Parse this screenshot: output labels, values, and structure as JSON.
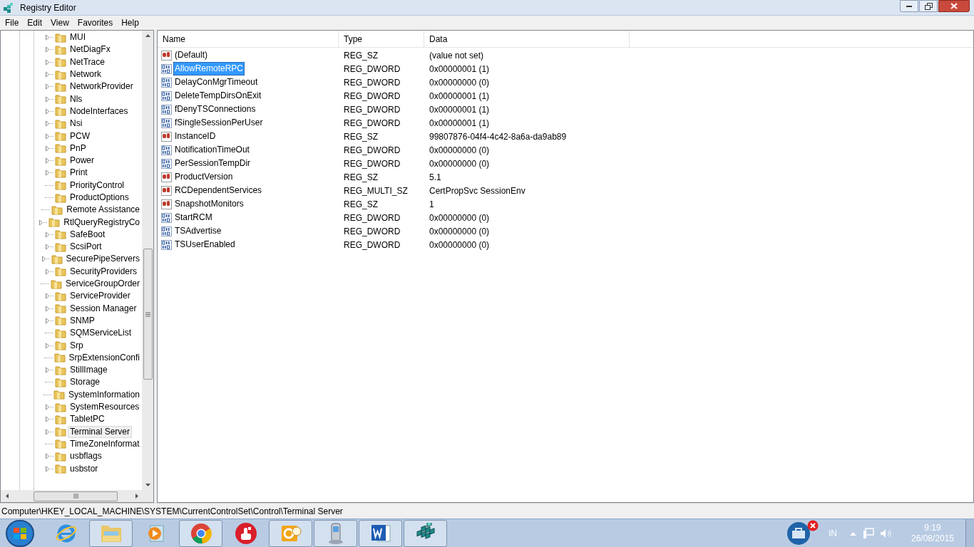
{
  "window": {
    "title": "Registry Editor"
  },
  "menu": [
    "File",
    "Edit",
    "View",
    "Favorites",
    "Help"
  ],
  "tree": {
    "items": [
      {
        "label": "MUI",
        "expandable": true,
        "selected": false
      },
      {
        "label": "NetDiagFx",
        "expandable": true,
        "selected": false
      },
      {
        "label": "NetTrace",
        "expandable": true,
        "selected": false
      },
      {
        "label": "Network",
        "expandable": true,
        "selected": false
      },
      {
        "label": "NetworkProvider",
        "expandable": true,
        "selected": false
      },
      {
        "label": "Nls",
        "expandable": true,
        "selected": false
      },
      {
        "label": "NodeInterfaces",
        "expandable": true,
        "selected": false
      },
      {
        "label": "Nsi",
        "expandable": true,
        "selected": false
      },
      {
        "label": "PCW",
        "expandable": true,
        "selected": false
      },
      {
        "label": "PnP",
        "expandable": true,
        "selected": false
      },
      {
        "label": "Power",
        "expandable": true,
        "selected": false
      },
      {
        "label": "Print",
        "expandable": true,
        "selected": false
      },
      {
        "label": "PriorityControl",
        "expandable": false,
        "selected": false
      },
      {
        "label": "ProductOptions",
        "expandable": false,
        "selected": false
      },
      {
        "label": "Remote Assistance",
        "expandable": false,
        "selected": false
      },
      {
        "label": "RtlQueryRegistryCo",
        "expandable": true,
        "selected": false
      },
      {
        "label": "SafeBoot",
        "expandable": true,
        "selected": false
      },
      {
        "label": "ScsiPort",
        "expandable": true,
        "selected": false
      },
      {
        "label": "SecurePipeServers",
        "expandable": true,
        "selected": false
      },
      {
        "label": "SecurityProviders",
        "expandable": true,
        "selected": false
      },
      {
        "label": "ServiceGroupOrder",
        "expandable": false,
        "selected": false
      },
      {
        "label": "ServiceProvider",
        "expandable": true,
        "selected": false
      },
      {
        "label": "Session Manager",
        "expandable": true,
        "selected": false
      },
      {
        "label": "SNMP",
        "expandable": true,
        "selected": false
      },
      {
        "label": "SQMServiceList",
        "expandable": false,
        "selected": false
      },
      {
        "label": "Srp",
        "expandable": true,
        "selected": false
      },
      {
        "label": "SrpExtensionConfi",
        "expandable": false,
        "selected": false
      },
      {
        "label": "StillImage",
        "expandable": true,
        "selected": false
      },
      {
        "label": "Storage",
        "expandable": false,
        "selected": false
      },
      {
        "label": "SystemInformation",
        "expandable": false,
        "selected": false
      },
      {
        "label": "SystemResources",
        "expandable": true,
        "selected": false
      },
      {
        "label": "TabletPC",
        "expandable": true,
        "selected": false
      },
      {
        "label": "Terminal Server",
        "expandable": true,
        "selected": true
      },
      {
        "label": "TimeZoneInformat",
        "expandable": false,
        "selected": false
      },
      {
        "label": "usbflags",
        "expandable": true,
        "selected": false
      },
      {
        "label": "usbstor",
        "expandable": true,
        "selected": false
      }
    ]
  },
  "values": {
    "columns": [
      "Name",
      "Type",
      "Data"
    ],
    "rows": [
      {
        "kind": "string",
        "name": "(Default)",
        "type": "REG_SZ",
        "data": "(value not set)",
        "selected": false
      },
      {
        "kind": "binary",
        "name": "AllowRemoteRPC",
        "type": "REG_DWORD",
        "data": "0x00000001 (1)",
        "selected": true
      },
      {
        "kind": "binary",
        "name": "DelayConMgrTimeout",
        "type": "REG_DWORD",
        "data": "0x00000000 (0)",
        "selected": false
      },
      {
        "kind": "binary",
        "name": "DeleteTempDirsOnExit",
        "type": "REG_DWORD",
        "data": "0x00000001 (1)",
        "selected": false
      },
      {
        "kind": "binary",
        "name": "fDenyTSConnections",
        "type": "REG_DWORD",
        "data": "0x00000001 (1)",
        "selected": false
      },
      {
        "kind": "binary",
        "name": "fSingleSessionPerUser",
        "type": "REG_DWORD",
        "data": "0x00000001 (1)",
        "selected": false
      },
      {
        "kind": "string",
        "name": "InstanceID",
        "type": "REG_SZ",
        "data": "99807876-04f4-4c42-8a6a-da9ab89",
        "selected": false
      },
      {
        "kind": "binary",
        "name": "NotificationTimeOut",
        "type": "REG_DWORD",
        "data": "0x00000000 (0)",
        "selected": false
      },
      {
        "kind": "binary",
        "name": "PerSessionTempDir",
        "type": "REG_DWORD",
        "data": "0x00000000 (0)",
        "selected": false
      },
      {
        "kind": "string",
        "name": "ProductVersion",
        "type": "REG_SZ",
        "data": "5.1",
        "selected": false
      },
      {
        "kind": "string",
        "name": "RCDependentServices",
        "type": "REG_MULTI_SZ",
        "data": "CertPropSvc SessionEnv",
        "selected": false
      },
      {
        "kind": "string",
        "name": "SnapshotMonitors",
        "type": "REG_SZ",
        "data": "1",
        "selected": false
      },
      {
        "kind": "binary",
        "name": "StartRCM",
        "type": "REG_DWORD",
        "data": "0x00000000 (0)",
        "selected": false
      },
      {
        "kind": "binary",
        "name": "TSAdvertise",
        "type": "REG_DWORD",
        "data": "0x00000000 (0)",
        "selected": false
      },
      {
        "kind": "binary",
        "name": "TSUserEnabled",
        "type": "REG_DWORD",
        "data": "0x00000000 (0)",
        "selected": false
      }
    ]
  },
  "status_bar": "Computer\\HKEY_LOCAL_MACHINE\\SYSTEM\\CurrentControlSet\\Control\\Terminal Server",
  "taskbar": {
    "apps": [
      {
        "kind": "browser-e",
        "running": false
      },
      {
        "kind": "folder",
        "running": true
      },
      {
        "kind": "media",
        "running": false
      },
      {
        "kind": "chrome",
        "running": true
      },
      {
        "kind": "hand",
        "running": false
      },
      {
        "kind": "mail",
        "running": true
      },
      {
        "kind": "phone",
        "running": true
      },
      {
        "kind": "word",
        "running": true
      },
      {
        "kind": "cubes",
        "running": true
      }
    ],
    "tray": {
      "language": "IN",
      "time": "9:19",
      "date": "26/08/2015"
    }
  }
}
